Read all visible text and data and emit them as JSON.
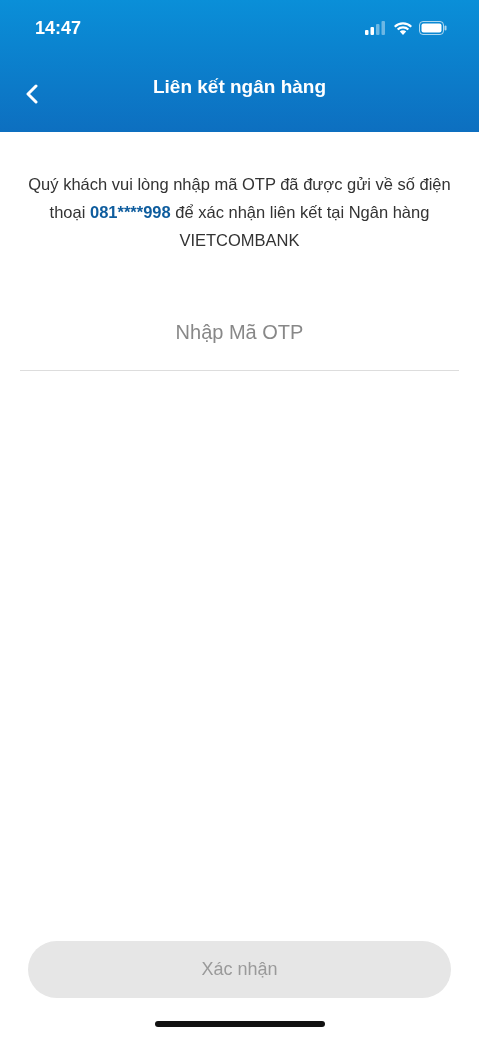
{
  "status_bar": {
    "time": "14:47"
  },
  "header": {
    "title": "Liên kết ngân hàng"
  },
  "message": {
    "before": "Quý khách vui lòng nhập mã OTP đã được gửi về số điện thoại",
    "phone": "081****998",
    "after": "để xác nhận liên kết tại Ngân hàng VIETCOMBANK"
  },
  "otp_field": {
    "placeholder": "Nhập Mã OTP"
  },
  "confirm_button": {
    "label": "Xác nhận",
    "disabled": true
  }
}
